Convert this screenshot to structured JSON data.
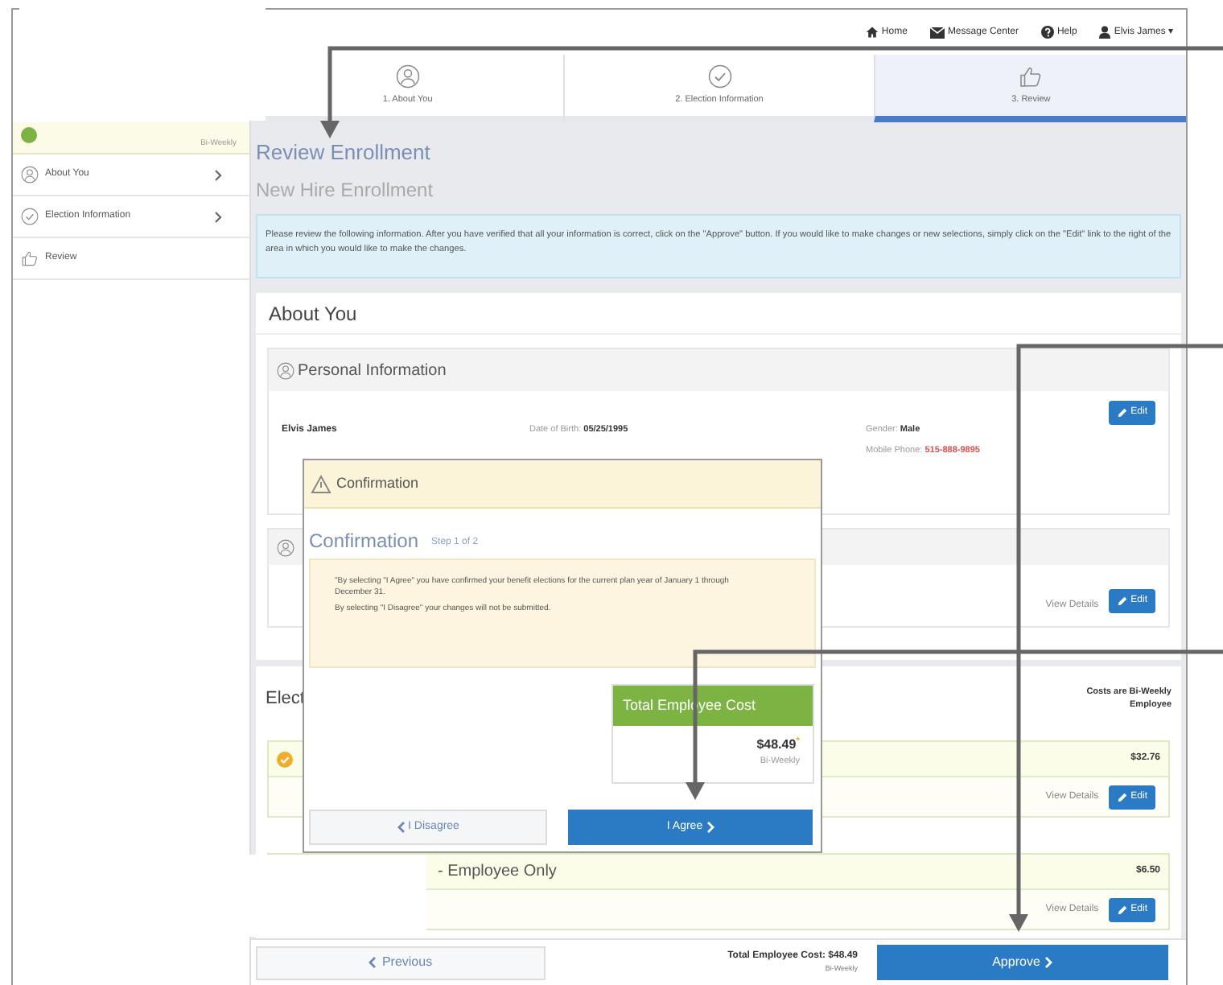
{
  "header_nav": [
    {
      "label": "Home"
    },
    {
      "label": "Message Center"
    },
    {
      "label": "Help"
    },
    {
      "label": "Elvis James ▾"
    }
  ],
  "steps": [
    {
      "label": "1. About You",
      "selected": false
    },
    {
      "label": "2. Election Information",
      "selected": false
    },
    {
      "label": "3. Review",
      "selected": true
    }
  ],
  "sidebar": {
    "summary_period": "Bi-Weekly",
    "items": [
      {
        "label": "About You",
        "chevron": true
      },
      {
        "label": "Election Information",
        "chevron": true
      },
      {
        "label": "Review",
        "chevron": false
      }
    ]
  },
  "page": {
    "title": "Review Enrollment",
    "subtitle": "New Hire Enrollment",
    "notice": "Please review the following information. After you have verified that all your information is correct, click on the \"Approve\" button. If you would like to make changes or new selections, simply click on the \"Edit\" link to the right of the area in which you would like to make the changes."
  },
  "about_you": {
    "title": "About You",
    "personal": {
      "title": "Personal Information",
      "edit": "Edit",
      "name": "Elvis James",
      "fields": [
        {
          "label": "Date of Birth:",
          "value": "05/25/1995",
          "color": "#333333"
        },
        {
          "label": "Gender:",
          "value": "Male",
          "color": "#333333"
        },
        {
          "label": "Mobile Phone:",
          "value": "515-888-9895",
          "color": "#d9534f"
        }
      ]
    },
    "second_panel": {
      "view_details": "View Details",
      "edit": "Edit"
    }
  },
  "elections": {
    "title": "Elect",
    "costs_note": [
      "Costs are Bi-Weekly",
      "Employee"
    ],
    "plans": [
      {
        "cost": "$32.76",
        "view_details": "View Details",
        "edit": "Edit"
      },
      {
        "name": "- Employee Only",
        "cost": "$6.50",
        "view_details": "View Details",
        "edit": "Edit"
      }
    ]
  },
  "footer": {
    "previous": "Previous",
    "total": "Total Employee Cost: $48.49",
    "total_period": "Bi-Weekly",
    "approve": "Approve"
  },
  "modal": {
    "header": "Confirmation",
    "title": "Confirmation",
    "step": "Step 1 of 2",
    "lines": [
      "\"By selecting \"I Agree\" you have confirmed your benefit elections for the current plan year of January 1 through December 31.",
      "By selecting \"I Disagree\" your changes will not be submitted."
    ],
    "total_title": "Total Employee Cost",
    "total_amount": "$48.49$^{*}$",
    "total_period": "Bi-Weekly",
    "disagree": "I Disagree",
    "agree": "I Agree"
  }
}
